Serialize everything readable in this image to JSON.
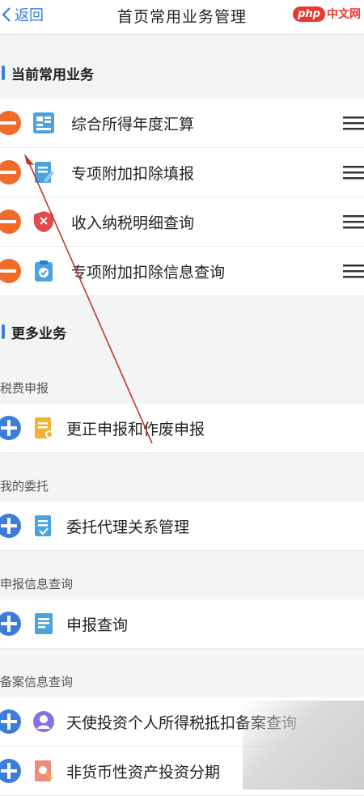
{
  "header": {
    "back_label": "返回",
    "title": "首页常用业务管理",
    "watermark_badge": "php",
    "watermark_text": "中文网"
  },
  "current": {
    "title": "当前常用业务",
    "items": [
      {
        "label": "综合所得年度汇算",
        "icon": "calculator-doc-icon"
      },
      {
        "label": "专项附加扣除填报",
        "icon": "edit-doc-icon"
      },
      {
        "label": "收入纳税明细查询",
        "icon": "tax-shield-icon"
      },
      {
        "label": "专项附加扣除信息查询",
        "icon": "clipboard-check-icon"
      }
    ]
  },
  "more": {
    "title": "更多业务",
    "groups": [
      {
        "name": "税费申报",
        "items": [
          {
            "label": "更正申报和作废申报",
            "icon": "correction-doc-icon"
          }
        ]
      },
      {
        "name": "我的委托",
        "items": [
          {
            "label": "委托代理关系管理",
            "icon": "delegation-doc-icon"
          }
        ]
      },
      {
        "name": "申报信息查询",
        "items": [
          {
            "label": "申报查询",
            "icon": "report-doc-icon"
          }
        ]
      },
      {
        "name": "备案信息查询",
        "items": [
          {
            "label": "天使投资个人所得税抵扣备案查询",
            "icon": "person-icon"
          },
          {
            "label": "非货币性资产投资分期",
            "icon": "asset-search-icon"
          }
        ]
      }
    ]
  },
  "colors": {
    "accent": "#3b7ddd",
    "remove": "#f06a2a",
    "add": "#3b7ddd",
    "annotation": "#c0392b"
  }
}
